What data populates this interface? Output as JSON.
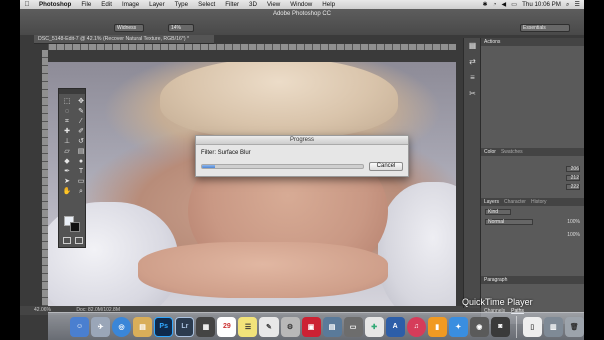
{
  "menubar": {
    "apple_icon": "",
    "app_name": "Photoshop",
    "items": [
      "File",
      "Edit",
      "Image",
      "Layer",
      "Type",
      "Select",
      "Filter",
      "3D",
      "View",
      "Window",
      "Help"
    ],
    "clock": "Thu 10:06 PM"
  },
  "window_title": "Adobe Photoshop CC",
  "options_bar": {
    "brush_mode": "Widness",
    "value": "14%",
    "workspace": "Essentials"
  },
  "document": {
    "tab_title": "DSC_5148-Edit-7 @ 42.1% (Recover Natural Texture, RGB/16*) *",
    "zoom": "42.06%",
    "doc_size": "Doc: 82.0M/102.8M"
  },
  "dialog": {
    "title": "Progress",
    "label": "Filter: Surface Blur",
    "progress": 0.08,
    "cancel_label": "Cancel"
  },
  "panels": {
    "actions_tab": "Actions",
    "color_tab": "Color",
    "swatches_tab": "Swatches",
    "rgb": [
      "206",
      "212",
      "222"
    ],
    "layers_tab": "Layers",
    "character_tab": "Character",
    "history_tab": "History",
    "kind_filter": "Kind",
    "blend_mode": "Normal",
    "opacity": "100%",
    "fill": "100%",
    "paragraph_tab": "Paragraph",
    "channels_tab": "Channels",
    "paths_tab": "Paths"
  },
  "quicktime": {
    "label": "QuickTime Player"
  },
  "dock": {
    "ps_label": "Ps",
    "lr_label": "Lr",
    "calendar_day": "29"
  },
  "colors": {
    "menubar": "#d9d9d9",
    "progress_fill": "#4d86d6",
    "ps_blue": "#0e2a4d",
    "lr_blue": "#2b3b4f"
  }
}
